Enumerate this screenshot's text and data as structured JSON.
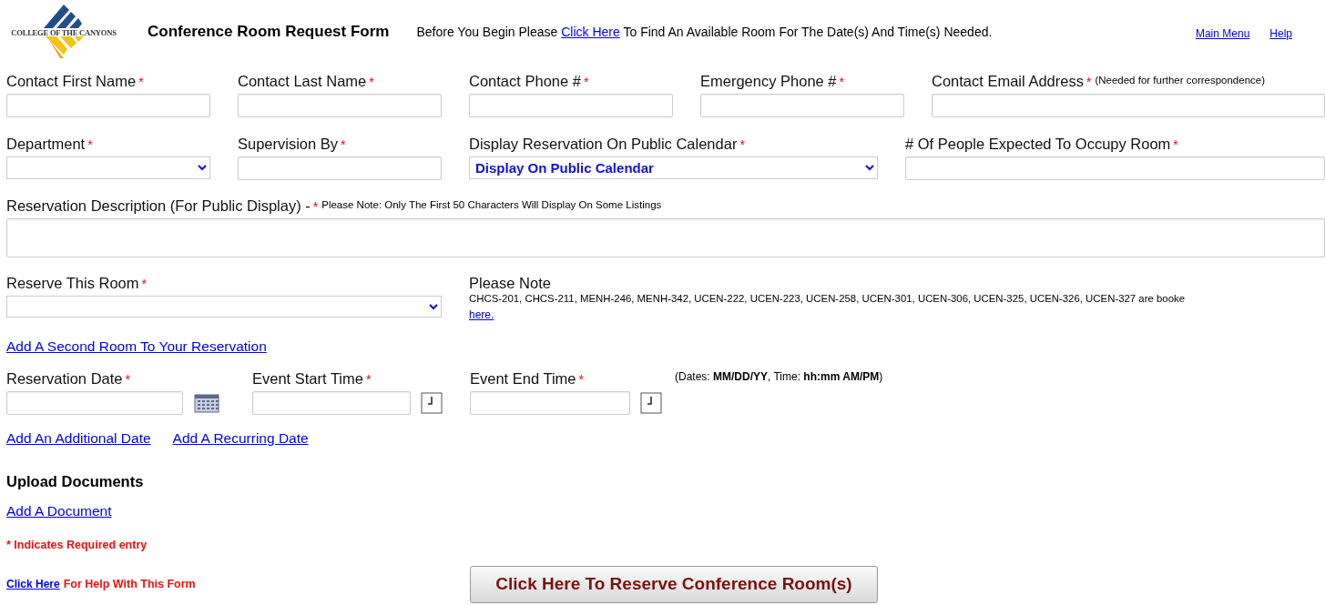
{
  "header": {
    "logo_text": "COLLEGE OF THE CANYONS",
    "title": "Conference Room Request Form",
    "intro": {
      "before": "Before You Begin Please",
      "link": "Click Here",
      "after": "To Find An Available Room For The Date(s) And Time(s) Needed."
    },
    "nav_links": [
      "Main Menu",
      "Help"
    ]
  },
  "rows": [
    {
      "kind": "fields",
      "fields": [
        {
          "label": "Contact First Name",
          "marker": "*",
          "kind": "text"
        },
        {
          "label": "Contact Last Name",
          "marker": "*",
          "kind": "text"
        },
        {
          "label": "Contact Phone #",
          "marker": "*",
          "kind": "text"
        },
        {
          "label": "Emergency Phone #",
          "marker": "*",
          "kind": "text"
        },
        {
          "label": "Contact Email Address",
          "marker": "*",
          "note": "(Needed for further correspondence)",
          "kind": "text"
        }
      ]
    },
    {
      "kind": "fields",
      "fields": [
        {
          "label": "Department",
          "marker": "*",
          "kind": "select"
        },
        {
          "label": "Supervision By",
          "marker": "*",
          "kind": "text"
        },
        {
          "label": "Display Reservation On Public Calendar",
          "marker": "*",
          "kind": "select",
          "value": "Display On Public Calendar"
        },
        {
          "label": "# Of People Expected To Occupy Room",
          "marker": "*",
          "kind": "text"
        }
      ]
    },
    {
      "kind": "description",
      "label": "Reservation Description (For Public Display) -",
      "note": "Please Note: Only The First 50 Characters Will Display On Some Listings",
      "marker": "*"
    },
    {
      "kind": "room",
      "label": "Reserve This Room",
      "marker": "*",
      "note_title": "Please Note",
      "note_text": "CHCS-201, CHCS-211, MENH-246, MENH-342, UCEN-222, UCEN-223, UCEN-258, UCEN-301, UCEN-306, UCEN-325, UCEN-326, UCEN-327 are booke",
      "note_link": "here.",
      "links": [
        "Add A Second Room To Your Reservation"
      ]
    },
    {
      "kind": "dates",
      "fields": [
        {
          "label": "Reservation Date",
          "marker": "*",
          "kind": "date"
        },
        {
          "label": "Event Start Time",
          "marker": "*",
          "kind": "time"
        },
        {
          "label": "Event End Time",
          "marker": "*",
          "kind": "time"
        }
      ],
      "hint": "(Dates: **MM/DD/YY**, Time: **hh:mm AM/PM**)",
      "links": [
        "Add An Additional Date",
        "Add A Recurring Date"
      ]
    },
    {
      "kind": "uploads",
      "heading": "Upload Documents",
      "links": [
        "Add A Document"
      ]
    }
  ],
  "footer": {
    "required_note": "* Indicates Required entry",
    "help_link": "Click Here",
    "help_text": "For Help With This Form",
    "submit": "Click Here To Reserve Conference Room(s)"
  }
}
